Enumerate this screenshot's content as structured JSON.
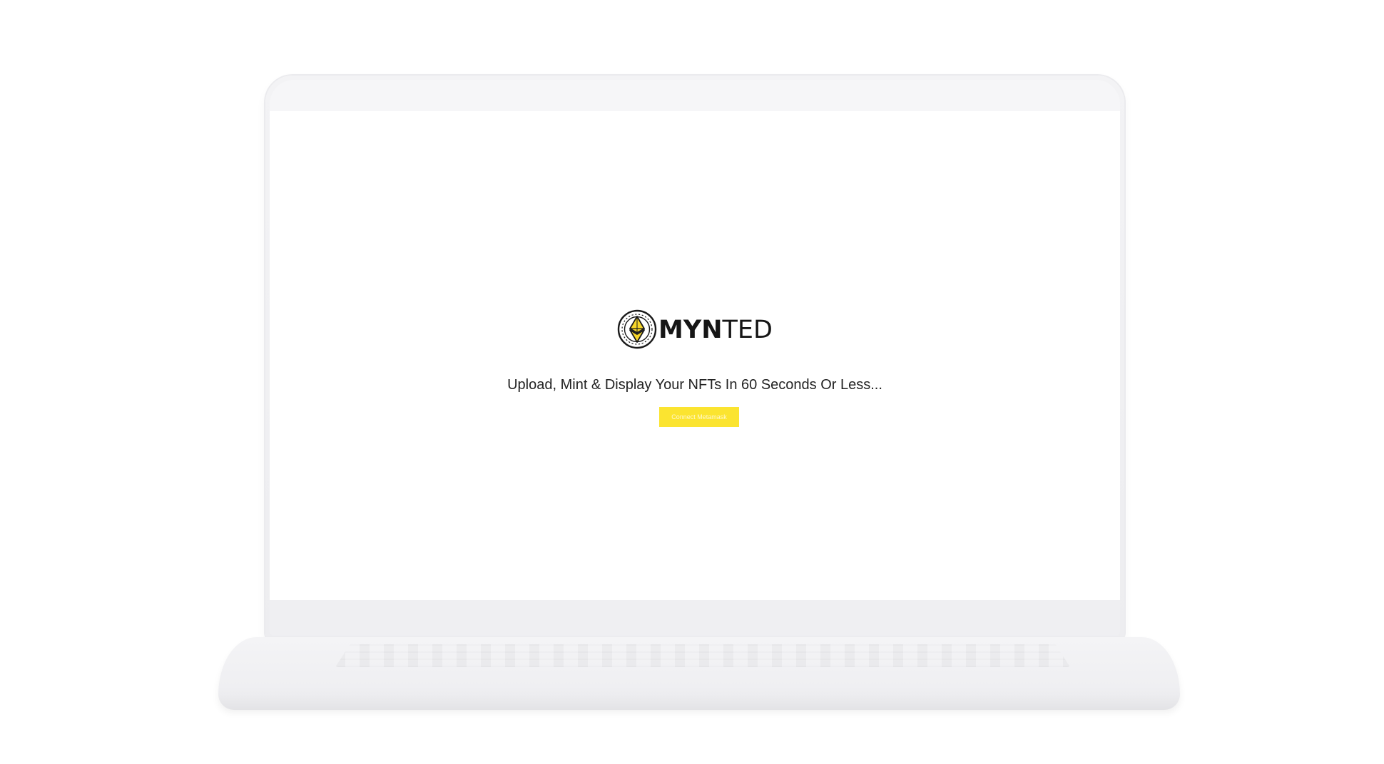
{
  "brand": {
    "name_bold": "MYN",
    "name_light": "TED",
    "logo_icon": "ethereum-coin-icon"
  },
  "hero": {
    "tagline": "Upload, Mint & Display Your NFTs In 60 Seconds Or Less..."
  },
  "actions": {
    "connect_label": "Connect Metamask"
  },
  "colors": {
    "accent": "#fbe430",
    "text": "#222222"
  }
}
